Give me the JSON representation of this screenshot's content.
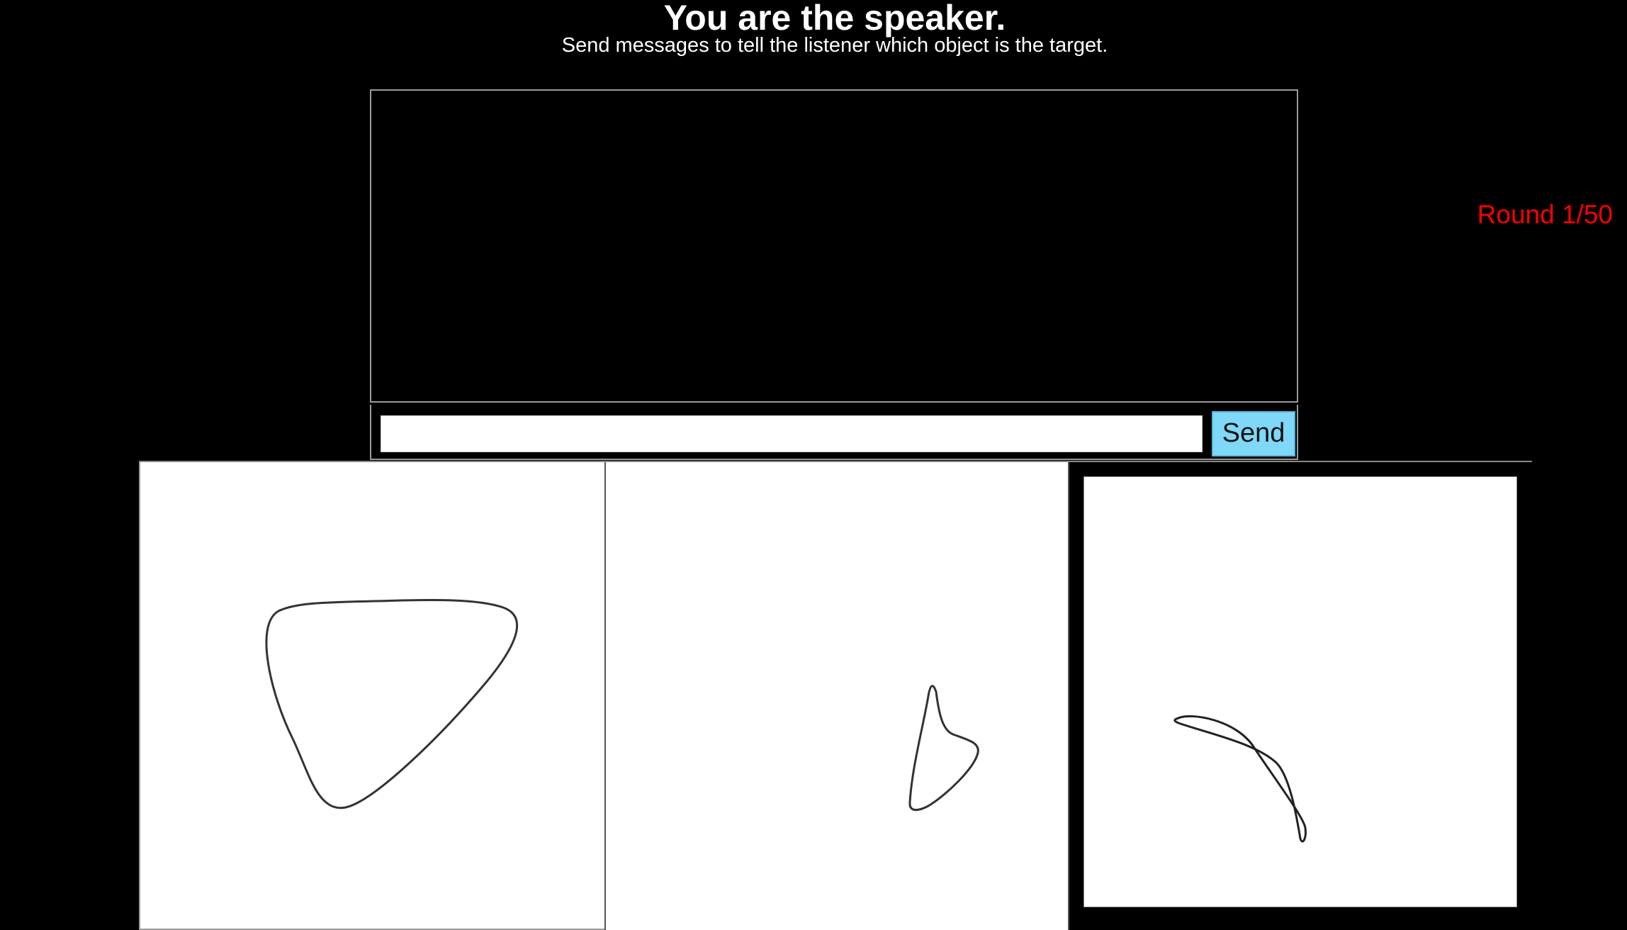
{
  "header": {
    "title": "You are the speaker.",
    "subtitle": "Send messages to tell the listener which object is the target."
  },
  "chat": {
    "messages": [],
    "input_value": "",
    "send_label": "Send"
  },
  "status": {
    "round_label": "Round 1/50"
  },
  "objects": [
    {
      "shape": "rounded-triangle-outline",
      "highlighted": false
    },
    {
      "shape": "small-pointed-loop-outline",
      "highlighted": false
    },
    {
      "shape": "crossed-crescent-outline",
      "highlighted": true
    }
  ],
  "colors": {
    "background": "#000000",
    "text": "#ffffff",
    "round": "#ff0000",
    "send_button": "#7fd8f8",
    "panel_border": "#9a9a9a",
    "card": "#ffffff"
  }
}
